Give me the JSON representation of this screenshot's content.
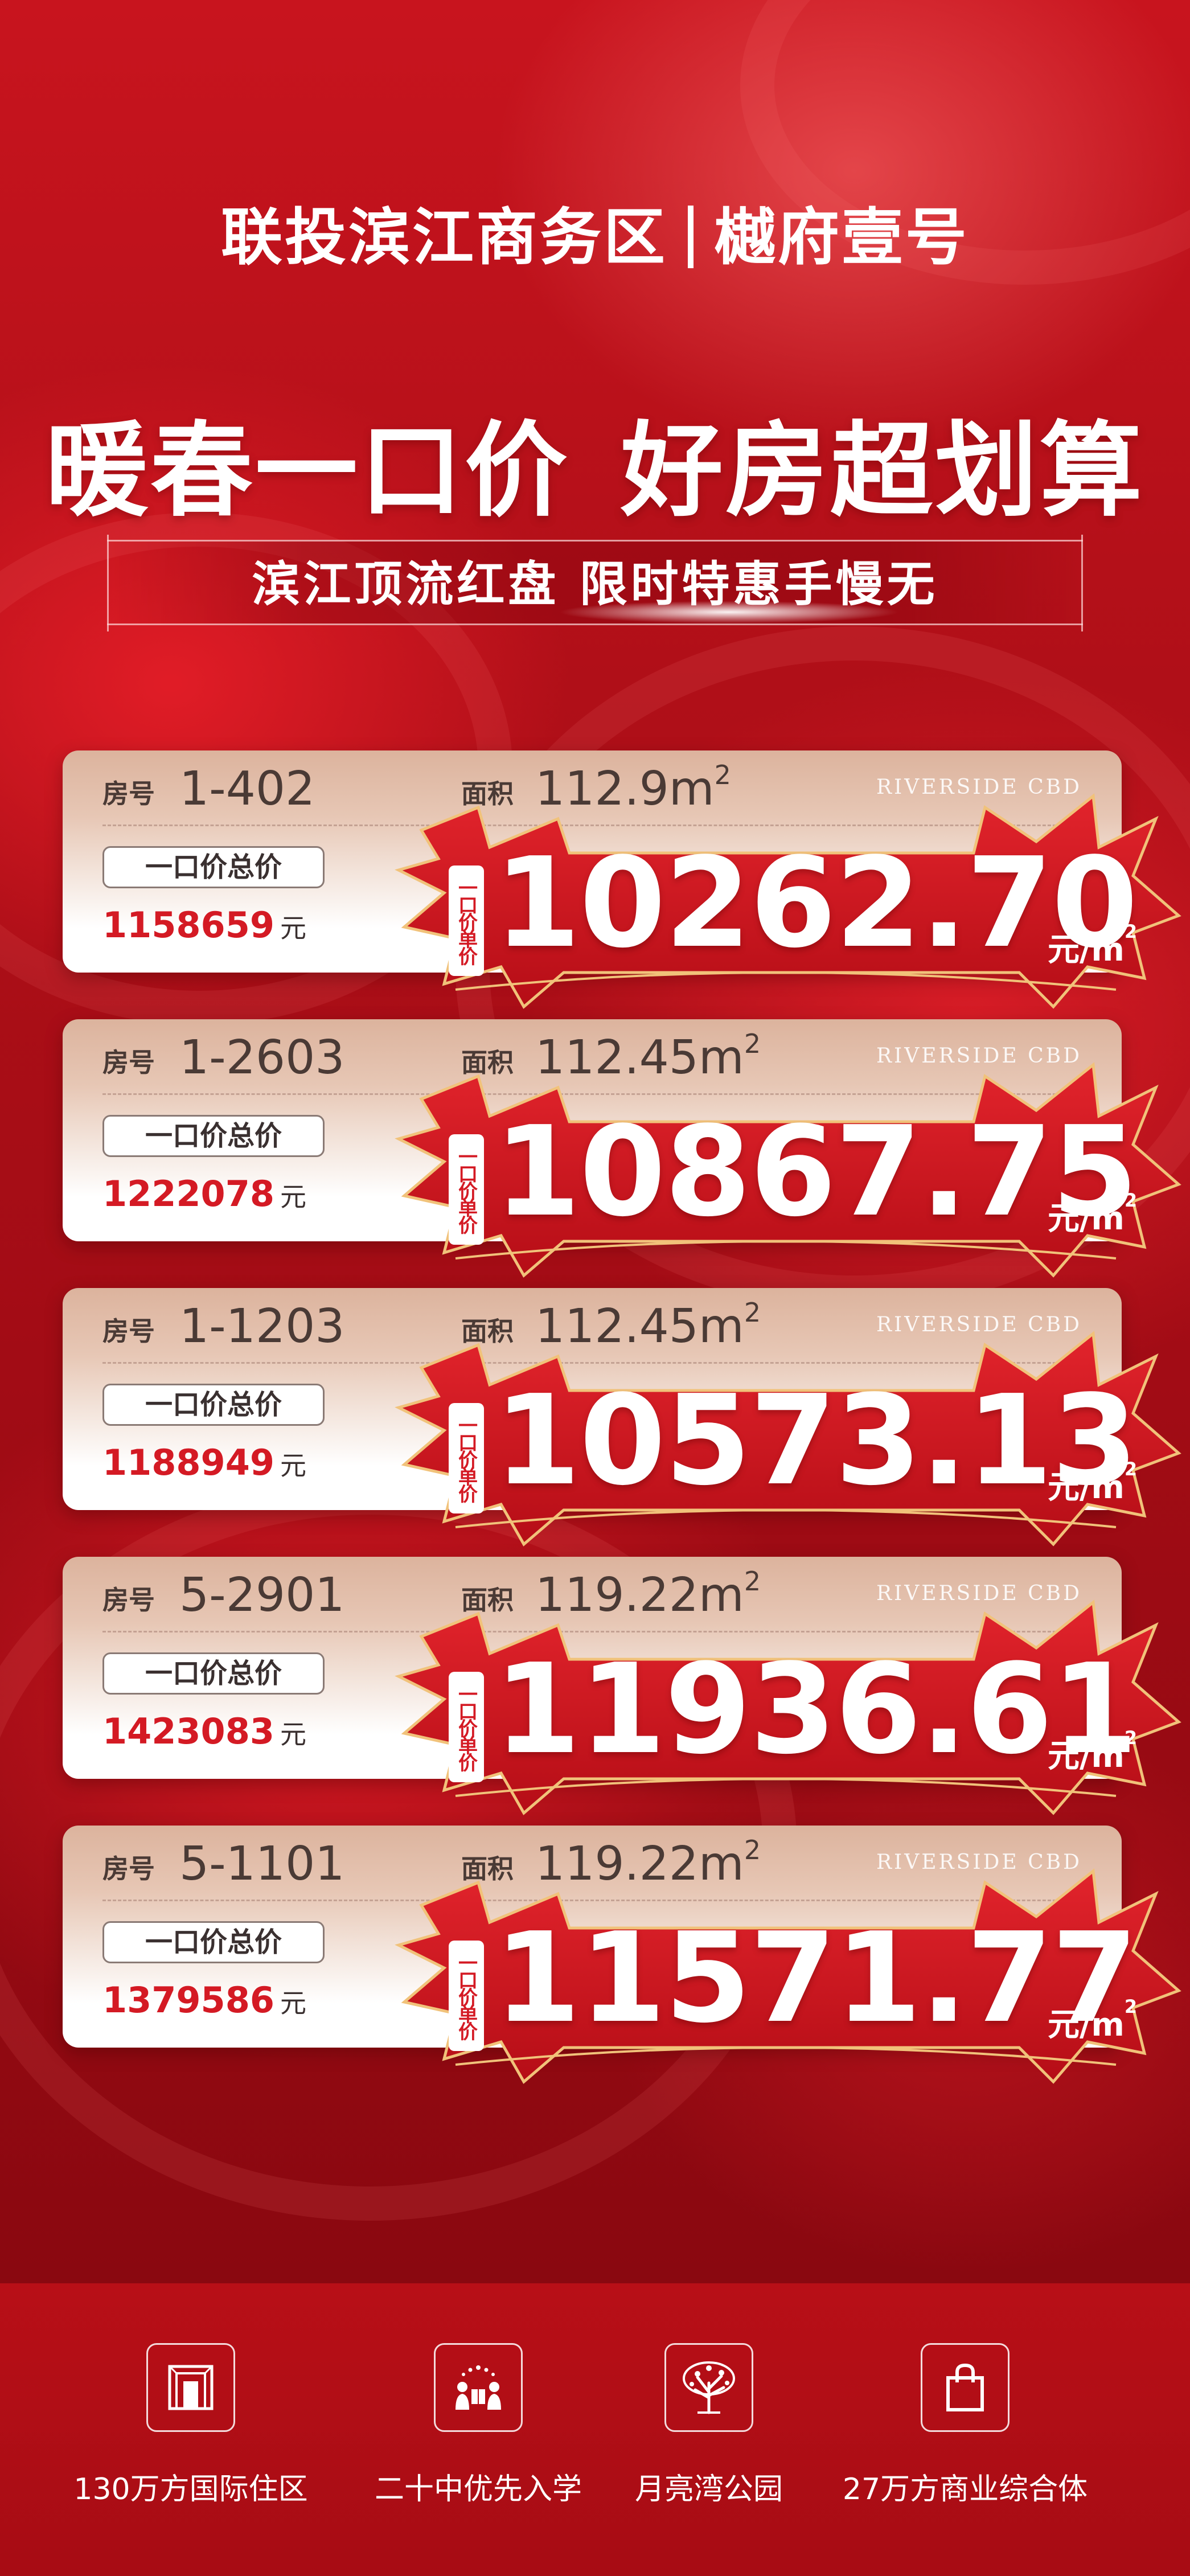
{
  "header": {
    "title_left": "联投滨江商务区",
    "title_right": "樾府壹号",
    "slogan_left": "暖春一口价",
    "slogan_right": "好房超划算",
    "subtitle": "滨江顶流红盘 限时特惠手慢无"
  },
  "card_labels": {
    "room": "房号",
    "area": "面积",
    "brand": "RIVERSIDE CBD",
    "total_label": "一口价总价",
    "yuan": "元",
    "unit_price_tag": "一口价单价",
    "unit": "元/m",
    "area_unit": "m"
  },
  "listings": [
    {
      "room": "1-402",
      "area": "112.9",
      "total": "1158659",
      "unit_price": "10262.70"
    },
    {
      "room": "1-2603",
      "area": "112.45",
      "total": "1222078",
      "unit_price": "10867.75"
    },
    {
      "room": "1-1203",
      "area": "112.45",
      "total": "1188949",
      "unit_price": "10573.13"
    },
    {
      "room": "5-2901",
      "area": "119.22",
      "total": "1423083",
      "unit_price": "11936.61"
    },
    {
      "room": "5-1101",
      "area": "119.22",
      "total": "1379586",
      "unit_price": "11571.77"
    }
  ],
  "features": [
    {
      "label": "130万方国际住区",
      "icon": "building-gate-icon"
    },
    {
      "label": "二十中优先入学",
      "icon": "school-students-icon"
    },
    {
      "label": "月亮湾公园",
      "icon": "tree-icon"
    },
    {
      "label": "27万方商业综合体",
      "icon": "shopping-bag-icon"
    }
  ],
  "colors": {
    "brand_red": "#d41a24",
    "background_red": "#b00f18",
    "card_text": "#4a3a35"
  }
}
